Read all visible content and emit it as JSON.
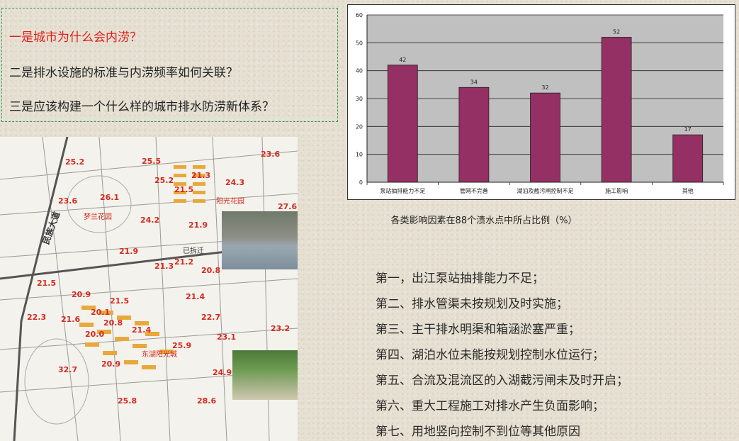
{
  "questions": [
    "一是城市为什么会内涝？",
    "二是排水设施的标准与内涝频率如何关联？",
    "三是应该构建一个什么样的城市排水防涝新体系？"
  ],
  "chart_data": {
    "type": "bar",
    "title": "各类影响因素在88个渍水点中所占比例（%）",
    "categories": [
      "泵站抽排能力不足",
      "管网不完善",
      "湖泊及截污闸控制不足",
      "施工影响",
      "其他"
    ],
    "values": [
      42,
      34,
      32,
      52,
      17
    ],
    "ylim": [
      0,
      60
    ],
    "yticks": [
      0,
      10,
      20,
      30,
      40,
      50,
      60
    ],
    "grid": true,
    "colors": {
      "bar": "#943063",
      "plot_bg": "#c0c0c0"
    }
  },
  "map": {
    "road_label": "民族大道",
    "place_labels": [
      "梦兰花园",
      "阳光花园",
      "已拆迁",
      "东湖阳光城"
    ],
    "depth_labels": [
      "25.2",
      "25.5",
      "23.6",
      "21.3",
      "25.2",
      "24.3",
      "21.5",
      "23.6",
      "26.1",
      "27.6",
      "24.2",
      "21.9",
      "21.9",
      "21.3",
      "21.2",
      "20.8",
      "21.5",
      "20.9",
      "21.5",
      "21.4",
      "22.3",
      "21.6",
      "20.1",
      "20.8",
      "21.4",
      "22.7",
      "23.2",
      "20.0",
      "23.1",
      "25.9",
      "20.9",
      "32.7",
      "24.9",
      "25.8",
      "28.6"
    ]
  },
  "reasons": [
    "第一，出江泵站抽排能力不足；",
    "第二、排水管渠未按规划及时实施；",
    "第三、主干排水明渠和箱涵淤塞严重；",
    "第四、湖泊水位未能按规划控制水位运行；",
    "第五、合流及混流区的入湖截污闸未及时开启；",
    "第六、重大工程施工对排水产生负面影响；",
    "第七、用地竖向控制不到位等其他原因"
  ]
}
